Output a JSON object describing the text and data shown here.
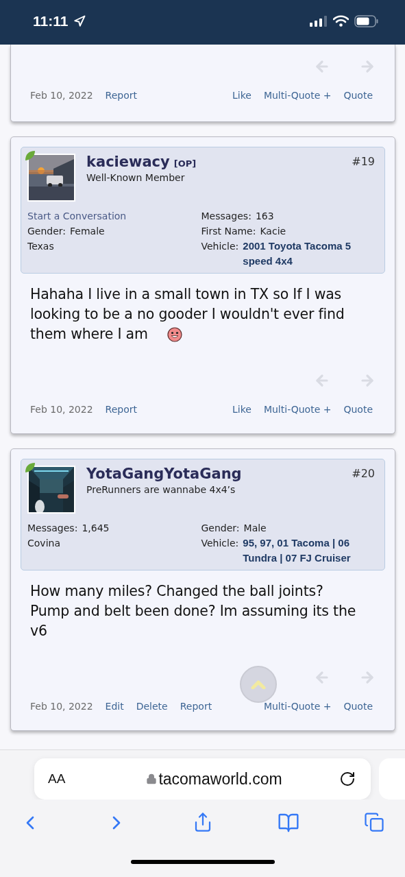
{
  "status_bar": {
    "time": "11:11"
  },
  "posts": [
    {
      "partial": true,
      "footer": {
        "date": "Feb 10, 2022",
        "left_links": [
          "Report"
        ],
        "right_links": [
          "Like",
          "Multi-Quote +",
          "Quote"
        ]
      }
    },
    {
      "partial": false,
      "number": "#19",
      "user": {
        "name": "kaciewacy",
        "badge": "[OP]",
        "title": "Well-Known Member"
      },
      "details_left": [
        {
          "kind": "link",
          "text": "Start a Conversation"
        },
        {
          "kind": "field",
          "label": "Gender:",
          "value": "Female"
        },
        {
          "kind": "plain",
          "text": "Texas"
        }
      ],
      "details_right": [
        {
          "kind": "field",
          "label": "Messages:",
          "value": "163"
        },
        {
          "kind": "field",
          "label": "First Name:",
          "value": "Kacie"
        },
        {
          "kind": "strong_field",
          "label": "Vehicle:",
          "value": "2001 Toyota Tacoma 5 speed 4x4"
        }
      ],
      "body": "Hahaha I live in a small town in TX so If I was looking to be a no gooder I wouldn't ever find them where I am",
      "emoji": true,
      "scroll_top": false,
      "footer": {
        "date": "Feb 10, 2022",
        "left_links": [
          "Report"
        ],
        "right_links": [
          "Like",
          "Multi-Quote +",
          "Quote"
        ]
      }
    },
    {
      "partial": false,
      "number": "#20",
      "user": {
        "name": "YotaGangYotaGang",
        "title": "PreRunners are wannabe 4x4’s"
      },
      "details_left": [
        {
          "kind": "field",
          "label": "Messages:",
          "value": "1,645"
        },
        {
          "kind": "plain",
          "text": "Covina"
        }
      ],
      "details_right": [
        {
          "kind": "field",
          "label": "Gender:",
          "value": "Male"
        },
        {
          "kind": "strong_field",
          "label": "Vehicle:",
          "value": "95, 97, 01 Tacoma | 06 Tundra | 07 FJ Cruiser"
        }
      ],
      "body": "How many miles? Changed the ball joints? Pump and belt been done? Im assuming its the v6",
      "emoji": false,
      "scroll_top": true,
      "footer": {
        "date": "Feb 10, 2022",
        "left_links": [
          "Edit",
          "Delete",
          "Report"
        ],
        "right_links": [
          "Multi-Quote +",
          "Quote"
        ]
      }
    }
  ],
  "browser": {
    "text_size": "AA",
    "url": "tacomaworld.com"
  }
}
